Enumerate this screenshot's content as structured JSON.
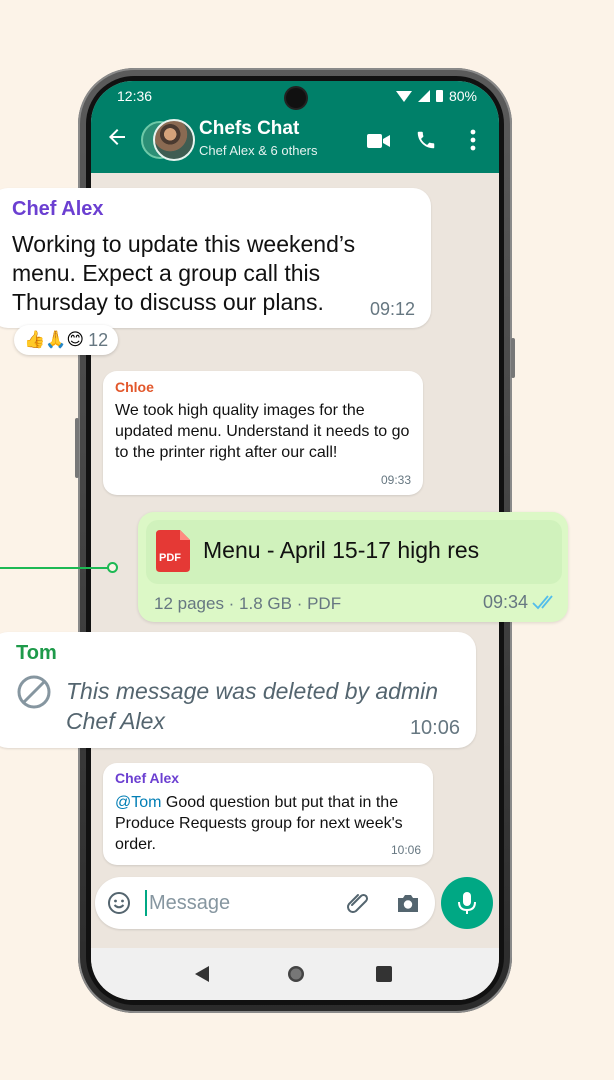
{
  "status": {
    "time": "12:36",
    "battery": "80%"
  },
  "header": {
    "title": "Chefs Chat",
    "subtitle": "Chef Alex & 6 others"
  },
  "messages": [
    {
      "sender": "Chef Alex",
      "text": "Working to update this weekend’s menu. Expect a group call this Thursday to discuss our plans.",
      "time": "09:12",
      "reactions": {
        "emojis": "👍🙏😊",
        "count": "12"
      }
    },
    {
      "sender": "Chloe",
      "text": "We took high quality images for the updated menu. Understand it needs to go to the printer right after our call!",
      "time": "09:33"
    },
    {
      "file_name": "Menu - April 15-17 high res",
      "file_icon_label": "PDF",
      "file_meta": "12 pages · 1.8 GB · PDF",
      "time": "09:34"
    },
    {
      "sender": "Tom",
      "text": "This message was deleted by admin Chef Alex",
      "time": "10:06"
    },
    {
      "sender": "Chef Alex",
      "mention": "@Tom",
      "text": " Good question but put that in the Produce Requests group for next week's order.",
      "time": "10:06"
    }
  ],
  "input": {
    "placeholder": "Message"
  },
  "colors": {
    "header": "#008069",
    "chat_bg": "#ece5dd",
    "outgoing_bubble": "#dcf8c6",
    "accent": "#00a884",
    "chef_alex_name": "#6b3fd1",
    "chloe_name": "#e2572b",
    "tom_name": "#1e9a4a",
    "mention": "#027eb5",
    "page_bg": "#fcf3e8"
  },
  "icons": [
    "back-arrow-icon",
    "video-call-icon",
    "voice-call-icon",
    "more-options-icon",
    "pdf-icon",
    "double-check-icon",
    "deleted-icon",
    "emoji-icon",
    "attach-icon",
    "camera-icon",
    "mic-icon",
    "nav-back-icon",
    "nav-home-icon",
    "nav-recents-icon"
  ]
}
